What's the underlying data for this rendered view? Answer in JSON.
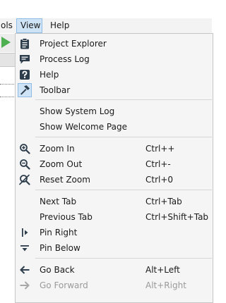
{
  "menubar": {
    "tools_label": "ols",
    "view_label": "View",
    "help_label": "Help"
  },
  "colors": {
    "accent": "#cfe3f7",
    "icon": "#2e3d4c",
    "run": "#4caf50"
  },
  "menu": {
    "items": [
      {
        "label": "Project Explorer",
        "icon": "clipboard-icon"
      },
      {
        "label": "Process Log",
        "icon": "chat-bubble-icon"
      },
      {
        "label": "Help",
        "icon": "question-icon"
      },
      {
        "label": "Toolbar",
        "icon": "hammer-icon",
        "checked": true
      },
      {
        "label": "Show System Log"
      },
      {
        "label": "Show Welcome Page"
      },
      {
        "label": "Zoom In",
        "shortcut": "Ctrl++",
        "icon": "zoom-in-icon"
      },
      {
        "label": "Zoom Out",
        "shortcut": "Ctrl+-",
        "icon": "zoom-out-icon"
      },
      {
        "label": "Reset Zoom",
        "shortcut": "Ctrl+0",
        "icon": "reset-zoom-icon"
      },
      {
        "label": "Next Tab",
        "shortcut": "Ctrl+Tab"
      },
      {
        "label": "Previous Tab",
        "shortcut": "Ctrl+Shift+Tab"
      },
      {
        "label": "Pin Right",
        "icon": "pin-right-icon"
      },
      {
        "label": "Pin Below",
        "icon": "pin-below-icon"
      },
      {
        "label": "Go Back",
        "shortcut": "Alt+Left",
        "icon": "arrow-left-icon"
      },
      {
        "label": "Go Forward",
        "shortcut": "Alt+Right",
        "icon": "arrow-right-icon",
        "disabled": true
      }
    ]
  }
}
